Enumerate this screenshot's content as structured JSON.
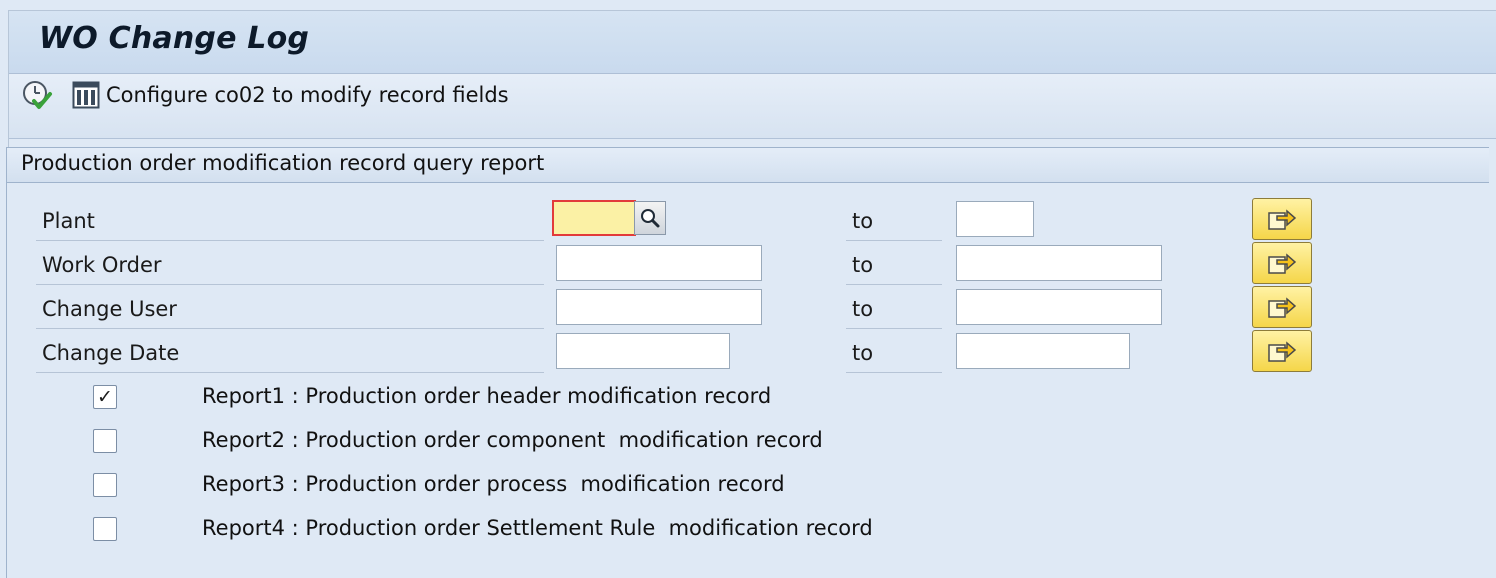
{
  "window": {
    "title": "WO Change Log"
  },
  "toolbar": {
    "execute_icon": "execute-clock-check-icon",
    "config_icon": "layout-table-icon",
    "config_label": "Configure co02 to modify record fields"
  },
  "group": {
    "title": "Production order modification record query report",
    "rows": [
      {
        "label": "Plant",
        "from_value": "",
        "to_label": "to",
        "to_value": ""
      },
      {
        "label": "Work Order",
        "from_value": "",
        "to_label": "to",
        "to_value": ""
      },
      {
        "label": "Change User",
        "from_value": "",
        "to_label": "to",
        "to_value": ""
      },
      {
        "label": "Change Date",
        "from_value": "",
        "to_label": "to",
        "to_value": ""
      }
    ],
    "reports": [
      {
        "label": "Report1 : Production order header modification record",
        "checked": true
      },
      {
        "label": "Report2 : Production order component  modification record",
        "checked": false
      },
      {
        "label": "Report3 : Production order process  modification record",
        "checked": false
      },
      {
        "label": "Report4 : Production order Settlement Rule  modification record",
        "checked": false
      }
    ]
  },
  "colors": {
    "background": "#dfe9f5",
    "active_field": "#fbf1a5",
    "active_border": "#e23b3b",
    "multi_button": "#f5d649"
  }
}
